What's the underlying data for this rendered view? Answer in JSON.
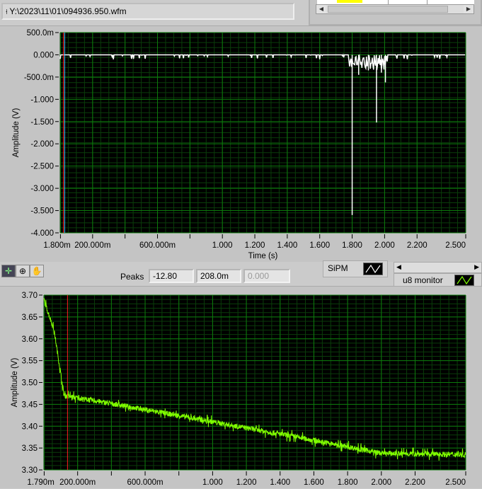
{
  "file_path": {
    "icon": "path-icon",
    "value": "Y:\\2023\\11\\01\\094936.950.wfm"
  },
  "colors": {
    "plot_bg": "#000000",
    "grid_major": "#0c7a0c",
    "grid_minor": "#0a3d0a",
    "top_trace": "#ffffff",
    "bottom_trace": "#7fff00",
    "cursor_red": "#ff2020",
    "cursor_cyan": "#40c0ff",
    "table_highlight": "#ffff00"
  },
  "toolbar": {
    "tools": [
      {
        "icon": "cursor-crosshair-icon"
      },
      {
        "icon": "zoom-icon"
      },
      {
        "icon": "pan-hand-icon"
      }
    ]
  },
  "peaks": {
    "label": "Peaks",
    "values": [
      "-12.80",
      "208.0m",
      "0.000"
    ]
  },
  "legend_top": {
    "label": "SiPM"
  },
  "legend_bottom": {
    "label": "u8 monitor"
  },
  "chart_data": [
    {
      "type": "line",
      "title": "",
      "xlabel": "Time (s)",
      "ylabel": "Amplitude (V)",
      "xlim": [
        0,
        2.5
      ],
      "ylim": [
        -4.0,
        0.5
      ],
      "grid": true,
      "y_ticks": [
        {
          "v": 0.5,
          "label": "500.0m"
        },
        {
          "v": 0,
          "label": "0.000"
        },
        {
          "v": -0.5,
          "label": "-500.0m"
        },
        {
          "v": -1,
          "label": "-1.000"
        },
        {
          "v": -1.5,
          "label": "-1.500"
        },
        {
          "v": -2,
          "label": "-2.000"
        },
        {
          "v": -2.5,
          "label": "-2.500"
        },
        {
          "v": -3,
          "label": "-3.000"
        },
        {
          "v": -3.5,
          "label": "-3.500"
        },
        {
          "v": -4,
          "label": "-4.000"
        }
      ],
      "x_ticks": [
        {
          "v": 0.0018,
          "label": "1.800m"
        },
        {
          "v": 0.2,
          "label": "200.000m"
        },
        {
          "v": 0.4,
          "label": ""
        },
        {
          "v": 0.6,
          "label": "600.000m"
        },
        {
          "v": 0.8,
          "label": ""
        },
        {
          "v": 1.0,
          "label": "1.000"
        },
        {
          "v": 1.2,
          "label": "1.200"
        },
        {
          "v": 1.4,
          "label": "1.400"
        },
        {
          "v": 1.6,
          "label": "1.600"
        },
        {
          "v": 1.8,
          "label": "1.800"
        },
        {
          "v": 2.0,
          "label": "2.000"
        },
        {
          "v": 2.2,
          "label": "2.200"
        },
        {
          "v": 2.5,
          "label": "2.500"
        }
      ],
      "cursors": [
        0.02,
        0.028
      ],
      "series": [
        {
          "name": "SiPM",
          "baseline": 0.0,
          "spikes": [
            {
              "x": 1.8,
              "y": -3.6
            },
            {
              "x": 1.95,
              "y": -1.52
            },
            {
              "x": 2.005,
              "y": -0.62
            },
            {
              "x": 1.84,
              "y": -0.45
            },
            {
              "x": 1.9,
              "y": -0.35
            },
            {
              "x": 1.98,
              "y": -0.4
            }
          ]
        }
      ]
    },
    {
      "type": "line",
      "title": "",
      "xlabel": "",
      "ylabel": "Amplitude (V)",
      "xlim": [
        0,
        2.5
      ],
      "ylim": [
        3.3,
        3.7
      ],
      "grid": true,
      "y_ticks": [
        {
          "v": 3.7,
          "label": "3.70"
        },
        {
          "v": 3.65,
          "label": "3.65"
        },
        {
          "v": 3.6,
          "label": "3.60"
        },
        {
          "v": 3.55,
          "label": "3.55"
        },
        {
          "v": 3.5,
          "label": "3.50"
        },
        {
          "v": 3.45,
          "label": "3.45"
        },
        {
          "v": 3.4,
          "label": "3.40"
        },
        {
          "v": 3.35,
          "label": "3.35"
        },
        {
          "v": 3.3,
          "label": "3.30"
        }
      ],
      "x_ticks": [
        {
          "v": 0.00179,
          "label": "1.790m"
        },
        {
          "v": 0.2,
          "label": "200.000m"
        },
        {
          "v": 0.4,
          "label": ""
        },
        {
          "v": 0.6,
          "label": "600.000m"
        },
        {
          "v": 0.8,
          "label": ""
        },
        {
          "v": 1.0,
          "label": "1.000"
        },
        {
          "v": 1.2,
          "label": "1.200"
        },
        {
          "v": 1.4,
          "label": "1.400"
        },
        {
          "v": 1.6,
          "label": "1.600"
        },
        {
          "v": 1.8,
          "label": "1.800"
        },
        {
          "v": 2.0,
          "label": "2.000"
        },
        {
          "v": 2.2,
          "label": "2.200"
        },
        {
          "v": 2.5,
          "label": "2.500"
        }
      ],
      "cursors": [
        0.14
      ],
      "series": [
        {
          "name": "u8 monitor",
          "points": [
            [
              0,
              3.69
            ],
            [
              0.06,
              3.62
            ],
            [
              0.12,
              3.47
            ],
            [
              0.5,
              3.445
            ],
            [
              1.0,
              3.41
            ],
            [
              1.5,
              3.375
            ],
            [
              2.0,
              3.338
            ],
            [
              2.5,
              3.335
            ]
          ],
          "noise": 0.012
        }
      ]
    }
  ]
}
